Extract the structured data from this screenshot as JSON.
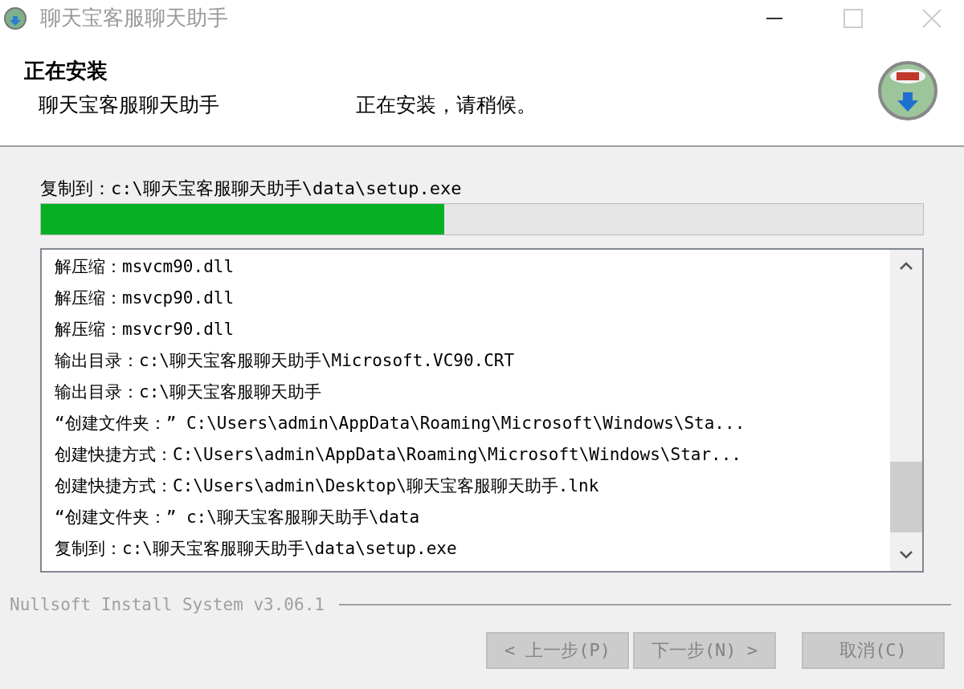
{
  "window": {
    "title": "聊天宝客服聊天助手"
  },
  "header": {
    "title": "正在安装",
    "subtitle": "聊天宝客服聊天助手",
    "message": "正在安装，请稍候。"
  },
  "status": "复制到：c:\\聊天宝客服聊天助手\\data\\setup.exe",
  "progress": {
    "level": 0.457
  },
  "log": [
    "解压缩：msvcm90.dll",
    "解压缩：msvcp90.dll",
    "解压缩：msvcr90.dll",
    "输出目录：c:\\聊天宝客服聊天助手\\Microsoft.VC90.CRT",
    "输出目录：c:\\聊天宝客服聊天助手",
    "“创建文件夹：” C:\\Users\\admin\\AppData\\Roaming\\Microsoft\\Windows\\Sta...",
    "创建快捷方式：C:\\Users\\admin\\AppData\\Roaming\\Microsoft\\Windows\\Star...",
    "创建快捷方式：C:\\Users\\admin\\Desktop\\聊天宝客服聊天助手.lnk",
    "“创建文件夹：” c:\\聊天宝客服聊天助手\\data",
    "复制到：c:\\聊天宝客服聊天助手\\data\\setup.exe"
  ],
  "branding": "Nullsoft Install System v3.06.1",
  "buttons": [
    {
      "label": "< 上一步(P)",
      "disabled": true,
      "kind": "back"
    },
    {
      "label": "下一步(N) >",
      "disabled": true,
      "kind": "next"
    },
    {
      "label": "取消(C)",
      "disabled": true,
      "kind": "cancel"
    }
  ]
}
